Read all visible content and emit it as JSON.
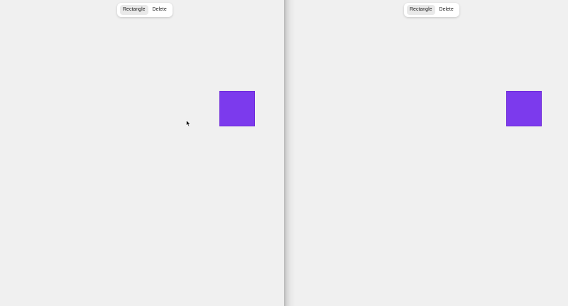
{
  "panes": [
    {
      "toolbar": {
        "rectangle_label": "Rectangle",
        "delete_label": "Delete"
      },
      "shape": {
        "kind": "rectangle",
        "fill": "#7c3aed"
      }
    },
    {
      "toolbar": {
        "rectangle_label": "Rectangle",
        "delete_label": "Delete"
      },
      "shape": {
        "kind": "rectangle",
        "fill": "#7c3aed"
      }
    }
  ],
  "cursor_icon": "arrow-pointer-icon"
}
